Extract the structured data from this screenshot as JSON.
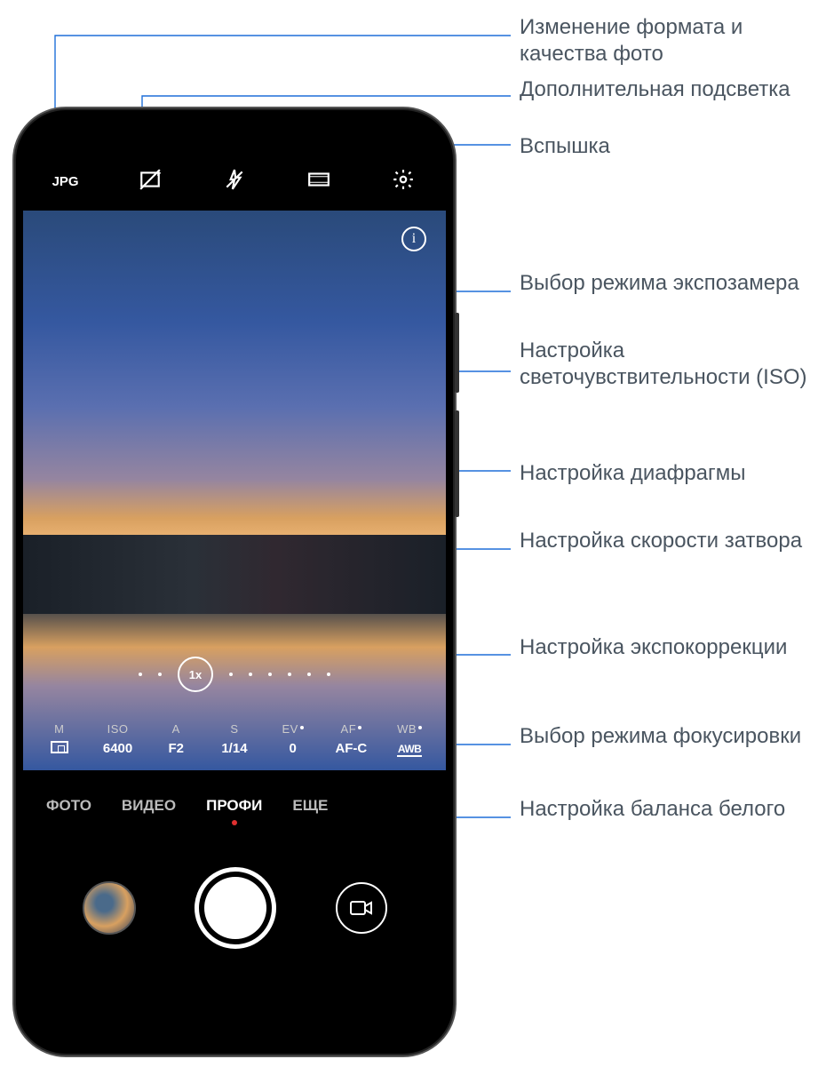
{
  "callouts": {
    "format": "Изменение формата и качества фото",
    "fill": "Дополнительная подсветка",
    "flash": "Вспышка",
    "metering": "Выбор режима экспозамера",
    "iso": "Настройка светочувствительности (ISO)",
    "aperture": "Настройка диафрагмы",
    "shutter": "Настройка скорости затвора",
    "ev": "Настройка экспокоррекции",
    "af": "Выбор режима фокусировки",
    "wb": "Настройка баланса белого"
  },
  "topbar": {
    "format_label": "JPG"
  },
  "viewfinder": {
    "info": "i",
    "zoom": "1x"
  },
  "params": {
    "metering": {
      "label": "M"
    },
    "iso": {
      "label": "ISO",
      "value": "6400"
    },
    "aperture": {
      "label": "A",
      "value": "F2"
    },
    "shutter": {
      "label": "S",
      "value": "1/14"
    },
    "ev": {
      "label": "EV",
      "value": "0"
    },
    "af": {
      "label": "AF",
      "value": "AF-C"
    },
    "wb": {
      "label": "WB",
      "value": "AWB"
    }
  },
  "modes": {
    "photo": "ФОТО",
    "video": "ВИДЕО",
    "pro": "ПРОФИ",
    "more": "ЕЩЕ"
  }
}
